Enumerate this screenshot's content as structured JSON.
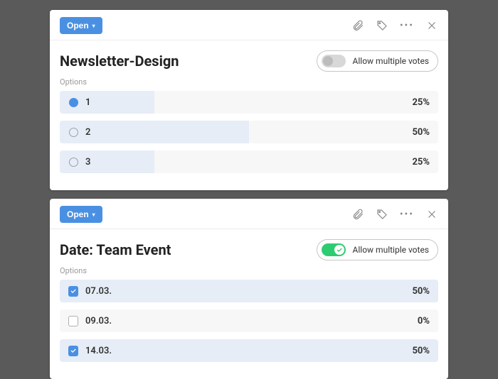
{
  "cards": [
    {
      "status_label": "Open",
      "title": "Newsletter-Design",
      "toggle": {
        "on": false,
        "label": "Allow multiple votes"
      },
      "options_label": "Options",
      "marker_type": "radio",
      "options": [
        {
          "label": "1",
          "pct": "25%",
          "fill": 25,
          "selected": true
        },
        {
          "label": "2",
          "pct": "50%",
          "fill": 50,
          "selected": false
        },
        {
          "label": "3",
          "pct": "25%",
          "fill": 25,
          "selected": false
        }
      ]
    },
    {
      "status_label": "Open",
      "title": "Date: Team Event",
      "toggle": {
        "on": true,
        "label": "Allow multiple votes"
      },
      "options_label": "Options",
      "marker_type": "checkbox",
      "options": [
        {
          "label": "07.03.",
          "pct": "50%",
          "fill": 100,
          "selected": true
        },
        {
          "label": "09.03.",
          "pct": "0%",
          "fill": 0,
          "selected": false
        },
        {
          "label": "14.03.",
          "pct": "50%",
          "fill": 100,
          "selected": true
        }
      ]
    }
  ]
}
